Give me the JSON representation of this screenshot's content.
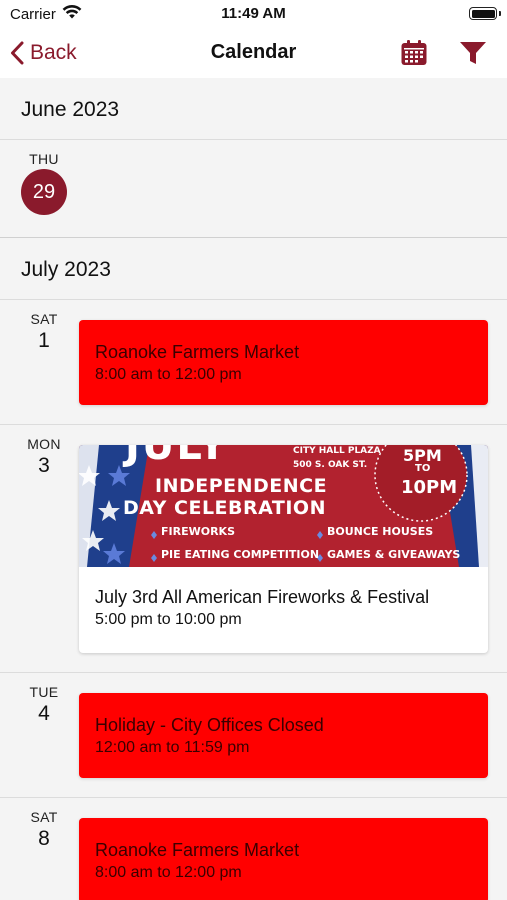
{
  "status": {
    "carrier": "Carrier",
    "time": "11:49 AM"
  },
  "nav": {
    "back_label": "Back",
    "title": "Calendar"
  },
  "months": [
    {
      "label": "June 2023"
    },
    {
      "label": "July 2023"
    }
  ],
  "june_days": [
    {
      "dow": "THU",
      "day": "29",
      "is_today": true
    }
  ],
  "july_days": [
    {
      "dow": "SAT",
      "day": "1",
      "event": {
        "title": "Roanoke Farmers Market",
        "time": "8:00 am to 12:00 pm",
        "color": "#ff0000"
      }
    },
    {
      "dow": "MON",
      "day": "3",
      "event": {
        "title": "July 3rd All American Fireworks & Festival",
        "time": "5:00 pm to 10:00 pm",
        "banner": {
          "top_word": "JULY",
          "venue_line1": "CITY HALL PLAZA",
          "venue_line2": "500 S. OAK ST.",
          "heading_line1": "INDEPENDENCE",
          "heading_line2": "DAY CELEBRATION",
          "start": "5PM",
          "to": "TO",
          "end": "10PM",
          "features": [
            "FIREWORKS",
            "BOUNCE HOUSES",
            "PIE EATING COMPETITION",
            "GAMES & GIVEAWAYS"
          ]
        }
      }
    },
    {
      "dow": "TUE",
      "day": "4",
      "event": {
        "title": "Holiday - City Offices Closed",
        "time": "12:00 am to 11:59 pm",
        "color": "#ff0000"
      }
    },
    {
      "dow": "SAT",
      "day": "8",
      "event": {
        "title": "Roanoke Farmers Market",
        "time": "8:00 am to 12:00 pm",
        "color": "#ff0000"
      }
    }
  ],
  "colors": {
    "accent": "#8a1a2c",
    "event_red": "#ff0000",
    "banner_red": "#b2222f",
    "banner_blue": "#1f3f8c"
  }
}
